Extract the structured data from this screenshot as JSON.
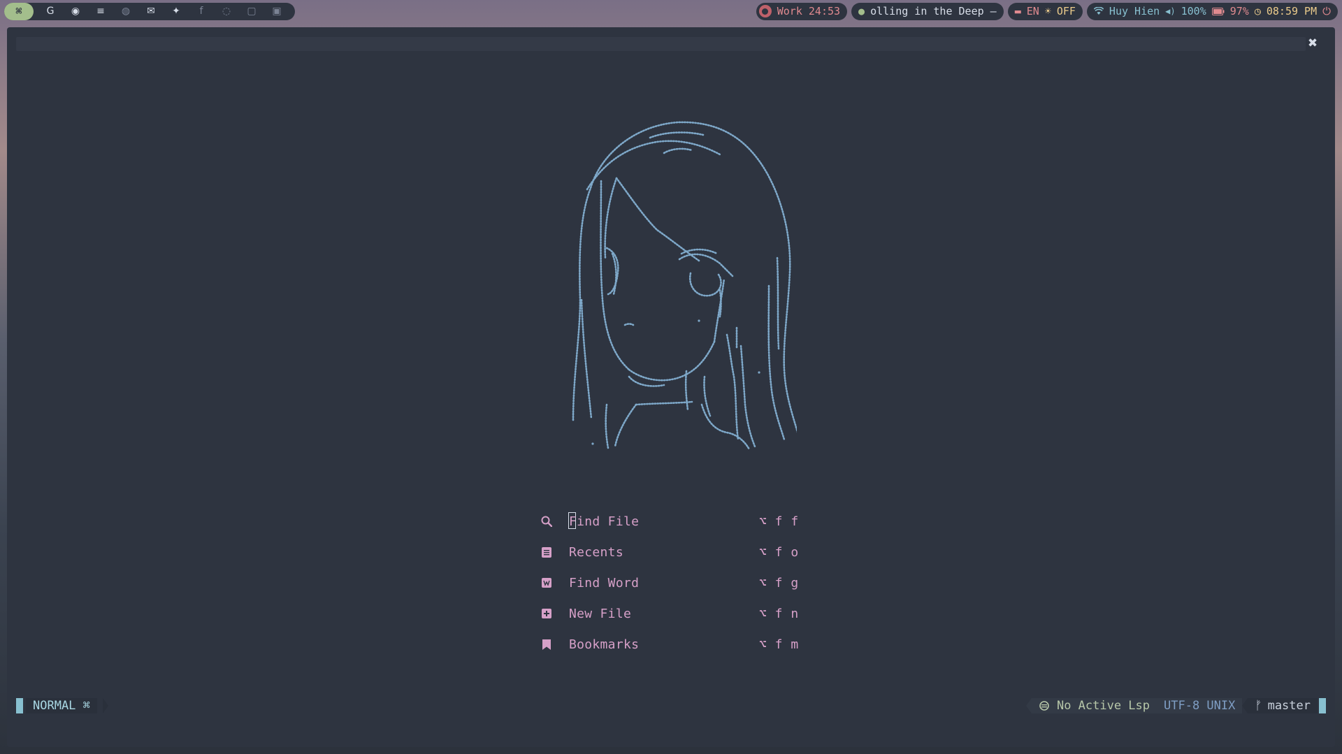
{
  "topbar": {
    "apple_symbol": "⌘",
    "apps": [
      {
        "icon": "google-icon",
        "glyph": "G"
      },
      {
        "icon": "github-icon",
        "glyph": "◉"
      },
      {
        "icon": "stackoverflow-icon",
        "glyph": "≡"
      },
      {
        "icon": "reddit-icon",
        "glyph": "◍"
      },
      {
        "icon": "mail-icon",
        "glyph": "✉"
      },
      {
        "icon": "twitter-icon",
        "glyph": "✦"
      },
      {
        "icon": "facebook-icon",
        "glyph": "f"
      },
      {
        "icon": "messenger-icon",
        "glyph": "◌"
      },
      {
        "icon": "twitch-icon",
        "glyph": "▢"
      },
      {
        "icon": "discord-icon",
        "glyph": "▣"
      }
    ],
    "work_timer": "Work 24:53",
    "music": "olling in the Deep –",
    "keyboard_lang": "EN",
    "keyboard_icon": "▬",
    "brightness_icon": "☀",
    "caffeine_state": "OFF",
    "wifi_icon": "wifi-icon",
    "wifi_name": "Huy Hien",
    "volume_icon": "🔈",
    "volume": "100%",
    "battery": "97%",
    "clock_icon": "◷",
    "time": "08:59 PM",
    "power_icon": "⏻"
  },
  "window": {
    "close_glyph": "✖"
  },
  "dashboard": {
    "items": [
      {
        "icon": "search-icon",
        "label": "Find File",
        "shortcut": "⌥ f f"
      },
      {
        "icon": "recent-files-icon",
        "label": "Recents",
        "shortcut": "⌥ f o"
      },
      {
        "icon": "find-word-icon",
        "label": "Find Word",
        "shortcut": "⌥ f g"
      },
      {
        "icon": "new-file-icon",
        "label": "New File",
        "shortcut": "⌥ f n"
      },
      {
        "icon": "bookmark-icon",
        "label": "Bookmarks",
        "shortcut": "⌥ f m"
      }
    ]
  },
  "statusline": {
    "mode": "NORMAL ⌘",
    "lsp": "No Active Lsp",
    "encoding": "UTF-8 UNIX",
    "branch": "master"
  },
  "colors": {
    "background": "#2e3440",
    "accent": "#88c0d0",
    "menu_pink": "#d6a0c8",
    "art_blue": "#7ea8c9"
  }
}
